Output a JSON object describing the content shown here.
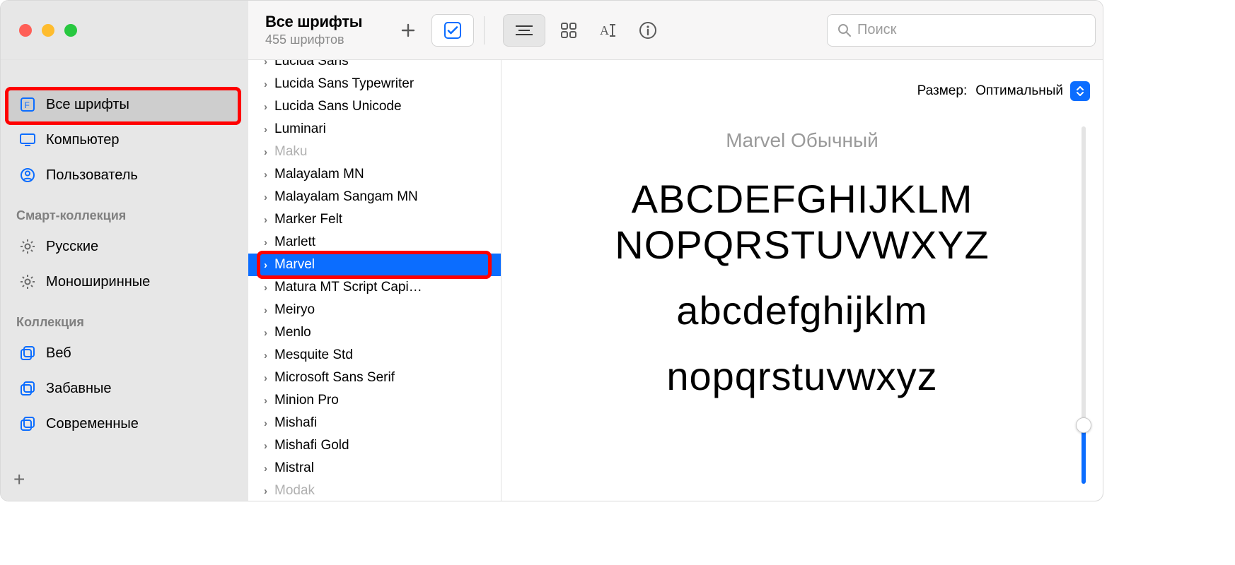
{
  "window": {
    "title": "Все шрифты",
    "subtitle": "455 шрифтов"
  },
  "search": {
    "placeholder": "Поиск"
  },
  "sidebar": {
    "top": [
      {
        "label": "Все шрифты",
        "active": true,
        "icon": "font-square"
      },
      {
        "label": "Компьютер",
        "active": false,
        "icon": "display"
      },
      {
        "label": "Пользователь",
        "active": false,
        "icon": "user-circle"
      }
    ],
    "smart_header": "Смарт-коллекция",
    "smart": [
      {
        "label": "Русские",
        "icon": "gear"
      },
      {
        "label": "Моноширинные",
        "icon": "gear"
      }
    ],
    "coll_header": "Коллекция",
    "coll": [
      {
        "label": "Веб",
        "icon": "collection"
      },
      {
        "label": "Забавные",
        "icon": "collection"
      },
      {
        "label": "Современные",
        "icon": "collection"
      }
    ]
  },
  "font_list": [
    {
      "name": "Lucida Sans",
      "muted": false,
      "selected": false,
      "partial": true
    },
    {
      "name": "Lucida Sans Typewriter",
      "muted": false,
      "selected": false
    },
    {
      "name": "Lucida Sans Unicode",
      "muted": false,
      "selected": false
    },
    {
      "name": "Luminari",
      "muted": false,
      "selected": false
    },
    {
      "name": "Maku",
      "muted": true,
      "selected": false
    },
    {
      "name": "Malayalam MN",
      "muted": false,
      "selected": false
    },
    {
      "name": "Malayalam Sangam MN",
      "muted": false,
      "selected": false
    },
    {
      "name": "Marker Felt",
      "muted": false,
      "selected": false
    },
    {
      "name": "Marlett",
      "muted": false,
      "selected": false
    },
    {
      "name": "Marvel",
      "muted": false,
      "selected": true
    },
    {
      "name": "Matura MT Script Capi…",
      "muted": false,
      "selected": false
    },
    {
      "name": "Meiryo",
      "muted": false,
      "selected": false
    },
    {
      "name": "Menlo",
      "muted": false,
      "selected": false
    },
    {
      "name": "Mesquite Std",
      "muted": false,
      "selected": false
    },
    {
      "name": "Microsoft Sans Serif",
      "muted": false,
      "selected": false
    },
    {
      "name": "Minion Pro",
      "muted": false,
      "selected": false
    },
    {
      "name": "Mishafi",
      "muted": false,
      "selected": false
    },
    {
      "name": "Mishafi Gold",
      "muted": false,
      "selected": false
    },
    {
      "name": "Mistral",
      "muted": false,
      "selected": false
    },
    {
      "name": "Modak",
      "muted": true,
      "selected": false
    }
  ],
  "preview": {
    "size_label": "Размер:",
    "size_value": "Оптимальный",
    "title": "Marvel Обычный",
    "line_upper1": "ABCDEFGHIJKLM",
    "line_upper2": "NOPQRSTUVWXYZ",
    "line_lower1": "abcdefghijklm",
    "line_lower2": "nopqrstuvwxyz"
  }
}
